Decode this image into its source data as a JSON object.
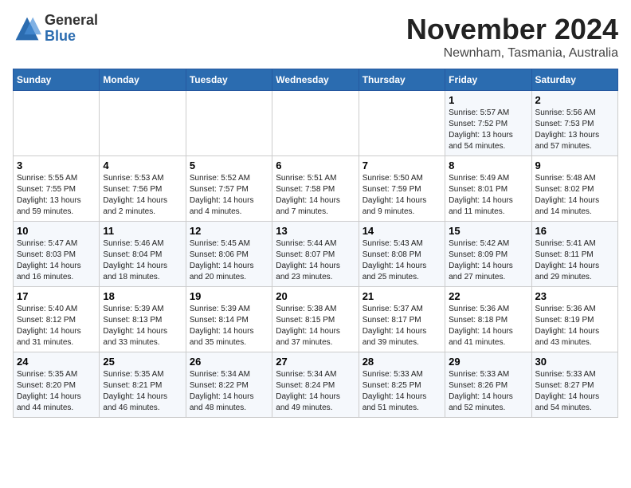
{
  "logo": {
    "general": "General",
    "blue": "Blue"
  },
  "title": "November 2024",
  "location": "Newnham, Tasmania, Australia",
  "weekdays": [
    "Sunday",
    "Monday",
    "Tuesday",
    "Wednesday",
    "Thursday",
    "Friday",
    "Saturday"
  ],
  "weeks": [
    [
      {
        "day": "",
        "info": ""
      },
      {
        "day": "",
        "info": ""
      },
      {
        "day": "",
        "info": ""
      },
      {
        "day": "",
        "info": ""
      },
      {
        "day": "",
        "info": ""
      },
      {
        "day": "1",
        "info": "Sunrise: 5:57 AM\nSunset: 7:52 PM\nDaylight: 13 hours\nand 54 minutes."
      },
      {
        "day": "2",
        "info": "Sunrise: 5:56 AM\nSunset: 7:53 PM\nDaylight: 13 hours\nand 57 minutes."
      }
    ],
    [
      {
        "day": "3",
        "info": "Sunrise: 5:55 AM\nSunset: 7:55 PM\nDaylight: 13 hours\nand 59 minutes."
      },
      {
        "day": "4",
        "info": "Sunrise: 5:53 AM\nSunset: 7:56 PM\nDaylight: 14 hours\nand 2 minutes."
      },
      {
        "day": "5",
        "info": "Sunrise: 5:52 AM\nSunset: 7:57 PM\nDaylight: 14 hours\nand 4 minutes."
      },
      {
        "day": "6",
        "info": "Sunrise: 5:51 AM\nSunset: 7:58 PM\nDaylight: 14 hours\nand 7 minutes."
      },
      {
        "day": "7",
        "info": "Sunrise: 5:50 AM\nSunset: 7:59 PM\nDaylight: 14 hours\nand 9 minutes."
      },
      {
        "day": "8",
        "info": "Sunrise: 5:49 AM\nSunset: 8:01 PM\nDaylight: 14 hours\nand 11 minutes."
      },
      {
        "day": "9",
        "info": "Sunrise: 5:48 AM\nSunset: 8:02 PM\nDaylight: 14 hours\nand 14 minutes."
      }
    ],
    [
      {
        "day": "10",
        "info": "Sunrise: 5:47 AM\nSunset: 8:03 PM\nDaylight: 14 hours\nand 16 minutes."
      },
      {
        "day": "11",
        "info": "Sunrise: 5:46 AM\nSunset: 8:04 PM\nDaylight: 14 hours\nand 18 minutes."
      },
      {
        "day": "12",
        "info": "Sunrise: 5:45 AM\nSunset: 8:06 PM\nDaylight: 14 hours\nand 20 minutes."
      },
      {
        "day": "13",
        "info": "Sunrise: 5:44 AM\nSunset: 8:07 PM\nDaylight: 14 hours\nand 23 minutes."
      },
      {
        "day": "14",
        "info": "Sunrise: 5:43 AM\nSunset: 8:08 PM\nDaylight: 14 hours\nand 25 minutes."
      },
      {
        "day": "15",
        "info": "Sunrise: 5:42 AM\nSunset: 8:09 PM\nDaylight: 14 hours\nand 27 minutes."
      },
      {
        "day": "16",
        "info": "Sunrise: 5:41 AM\nSunset: 8:11 PM\nDaylight: 14 hours\nand 29 minutes."
      }
    ],
    [
      {
        "day": "17",
        "info": "Sunrise: 5:40 AM\nSunset: 8:12 PM\nDaylight: 14 hours\nand 31 minutes."
      },
      {
        "day": "18",
        "info": "Sunrise: 5:39 AM\nSunset: 8:13 PM\nDaylight: 14 hours\nand 33 minutes."
      },
      {
        "day": "19",
        "info": "Sunrise: 5:39 AM\nSunset: 8:14 PM\nDaylight: 14 hours\nand 35 minutes."
      },
      {
        "day": "20",
        "info": "Sunrise: 5:38 AM\nSunset: 8:15 PM\nDaylight: 14 hours\nand 37 minutes."
      },
      {
        "day": "21",
        "info": "Sunrise: 5:37 AM\nSunset: 8:17 PM\nDaylight: 14 hours\nand 39 minutes."
      },
      {
        "day": "22",
        "info": "Sunrise: 5:36 AM\nSunset: 8:18 PM\nDaylight: 14 hours\nand 41 minutes."
      },
      {
        "day": "23",
        "info": "Sunrise: 5:36 AM\nSunset: 8:19 PM\nDaylight: 14 hours\nand 43 minutes."
      }
    ],
    [
      {
        "day": "24",
        "info": "Sunrise: 5:35 AM\nSunset: 8:20 PM\nDaylight: 14 hours\nand 44 minutes."
      },
      {
        "day": "25",
        "info": "Sunrise: 5:35 AM\nSunset: 8:21 PM\nDaylight: 14 hours\nand 46 minutes."
      },
      {
        "day": "26",
        "info": "Sunrise: 5:34 AM\nSunset: 8:22 PM\nDaylight: 14 hours\nand 48 minutes."
      },
      {
        "day": "27",
        "info": "Sunrise: 5:34 AM\nSunset: 8:24 PM\nDaylight: 14 hours\nand 49 minutes."
      },
      {
        "day": "28",
        "info": "Sunrise: 5:33 AM\nSunset: 8:25 PM\nDaylight: 14 hours\nand 51 minutes."
      },
      {
        "day": "29",
        "info": "Sunrise: 5:33 AM\nSunset: 8:26 PM\nDaylight: 14 hours\nand 52 minutes."
      },
      {
        "day": "30",
        "info": "Sunrise: 5:33 AM\nSunset: 8:27 PM\nDaylight: 14 hours\nand 54 minutes."
      }
    ]
  ]
}
